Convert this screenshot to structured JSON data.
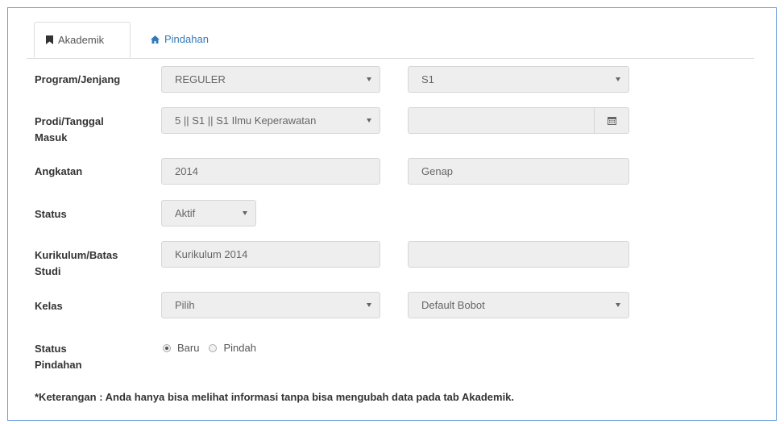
{
  "tabs": [
    {
      "label": "Akademik",
      "icon": "bookmark-icon",
      "active": true
    },
    {
      "label": "Pindahan",
      "icon": "home-icon",
      "active": false
    }
  ],
  "fields": {
    "program": {
      "label": "Program/Jenjang",
      "value1": "REGULER",
      "value2": "S1"
    },
    "prodi": {
      "label1": "Prodi/Tanggal",
      "label2": "Masuk",
      "value1": "5 || S1 || S1 Ilmu Keperawatan",
      "value2": ""
    },
    "angkatan": {
      "label": "Angkatan",
      "value1": "2014",
      "value2": "Genap"
    },
    "status": {
      "label": "Status",
      "value": "Aktif"
    },
    "kurikulum": {
      "label1": "Kurikulum/Batas",
      "label2": "Studi",
      "value1": "Kurikulum 2014",
      "value2": ""
    },
    "kelas": {
      "label": "Kelas",
      "value1": "Pilih",
      "value2": "Default Bobot"
    },
    "status_pindahan": {
      "label1": "Status",
      "label2": "Pindahan",
      "options": [
        "Baru",
        "Pindah"
      ],
      "selected": "Baru"
    }
  },
  "note": "*Keterangan : Anda hanya bisa melihat informasi tanpa bisa mengubah data pada tab Akademik.",
  "colors": {
    "panel_border": "#6aa0dc",
    "link": "#337ab7",
    "input_bg": "#eeeeee"
  }
}
